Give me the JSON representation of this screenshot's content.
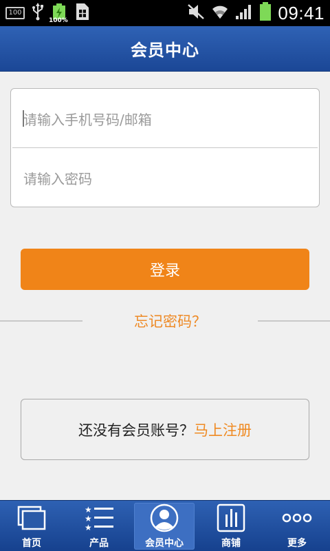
{
  "status_bar": {
    "time": "09:41",
    "battery_left_label": "100%",
    "badge_100": "100",
    "icons": [
      "badge-100-icon",
      "usb-icon",
      "battery-charging-icon",
      "sim-card-icon",
      "mute-icon",
      "wifi-icon",
      "signal-icon",
      "battery-icon"
    ]
  },
  "header": {
    "title": "会员中心"
  },
  "login": {
    "phone_placeholder": "请输入手机号码/邮箱",
    "password_placeholder": "请输入密码",
    "submit_label": "登录",
    "forgot_label": "忘记密码？"
  },
  "register": {
    "prompt": "还没有会员账号？",
    "link": "马上注册"
  },
  "tabbar": {
    "items": [
      {
        "label": "首页",
        "icon": "home-pages-icon",
        "active": false
      },
      {
        "label": "产品",
        "icon": "product-list-icon",
        "active": false
      },
      {
        "label": "会员中心",
        "icon": "member-avatar-icon",
        "active": true
      },
      {
        "label": "商铺",
        "icon": "store-chart-icon",
        "active": false
      },
      {
        "label": "更多",
        "icon": "more-dots-icon",
        "active": false
      }
    ]
  },
  "colors": {
    "header_bg": "#1f4c9c",
    "accent_orange": "#f08418",
    "page_bg": "#f0f0f0"
  }
}
